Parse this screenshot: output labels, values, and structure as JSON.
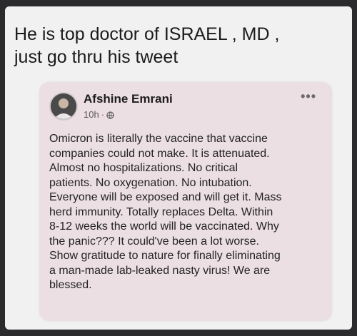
{
  "caption": "He is top doctor of ISRAEL , MD ,\njust go thru his tweet",
  "post": {
    "author": "Afshine Emrani",
    "time": "10h",
    "separator": "·",
    "audience_icon": "globe-icon",
    "more_label": "•••",
    "text": "Omicron is literally the vaccine that vaccine\ncompanies could not make.  It is attenuated.\nAlmost no hospitalizations.  No critical\npatients.  No oxygenation.  No intubation.\nEveryone will be exposed and will get it.  Mass\nherd immunity.  Totally replaces Delta.  Within\n8-12 weeks the world will be vaccinated.  Why\nthe panic???  It could've been a lot worse.\nShow gratitude to nature for finally eliminating\na man-made lab-leaked nasty virus!  We are\nblessed."
  }
}
